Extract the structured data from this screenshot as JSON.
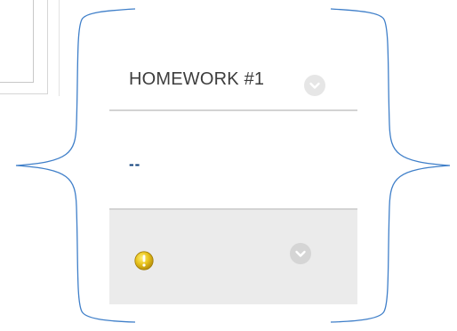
{
  "column": {
    "title": "HOMEWORK #1",
    "grade": "--"
  },
  "colors": {
    "brace": "#3f7fc9",
    "header_text": "#3d3d3d",
    "grade_text": "#0b3e7a",
    "alert_background": "#ebebeb",
    "warning_yellow": "#e8c21b",
    "divider": "#d3d3d3"
  },
  "icons": {
    "header_menu": "chevron-down-icon",
    "alert": "warning-icon",
    "alert_menu": "chevron-down-icon"
  }
}
